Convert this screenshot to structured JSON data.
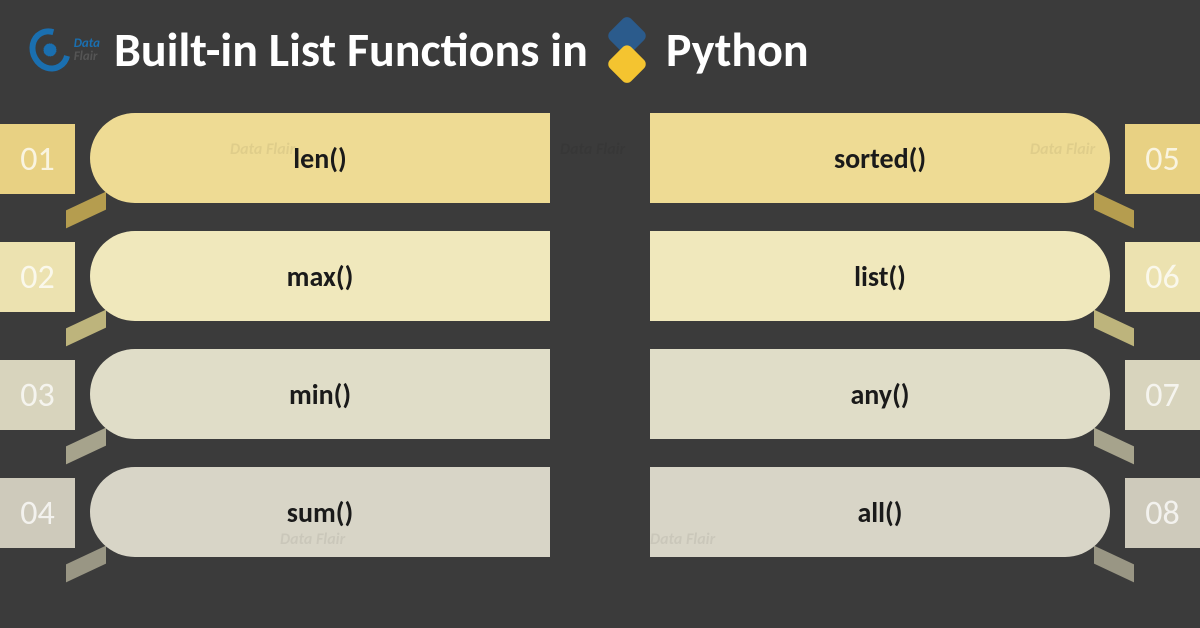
{
  "brand": {
    "name_line1": "Data",
    "name_line2": "Flair"
  },
  "title_part1": "Built-in List Functions in",
  "title_part2": "Python",
  "items": [
    {
      "num": "01",
      "label": "len()",
      "side": "left",
      "colorClass": "c1"
    },
    {
      "num": "05",
      "label": "sorted()",
      "side": "right",
      "colorClass": "c1"
    },
    {
      "num": "02",
      "label": "max()",
      "side": "left",
      "colorClass": "c2"
    },
    {
      "num": "06",
      "label": "list()",
      "side": "right",
      "colorClass": "c2"
    },
    {
      "num": "03",
      "label": "min()",
      "side": "left",
      "colorClass": "c3"
    },
    {
      "num": "07",
      "label": "any()",
      "side": "right",
      "colorClass": "c3"
    },
    {
      "num": "04",
      "label": "sum()",
      "side": "left",
      "colorClass": "c4"
    },
    {
      "num": "08",
      "label": "all()",
      "side": "right",
      "colorClass": "c4"
    }
  ],
  "watermark_text": "Data Flair"
}
